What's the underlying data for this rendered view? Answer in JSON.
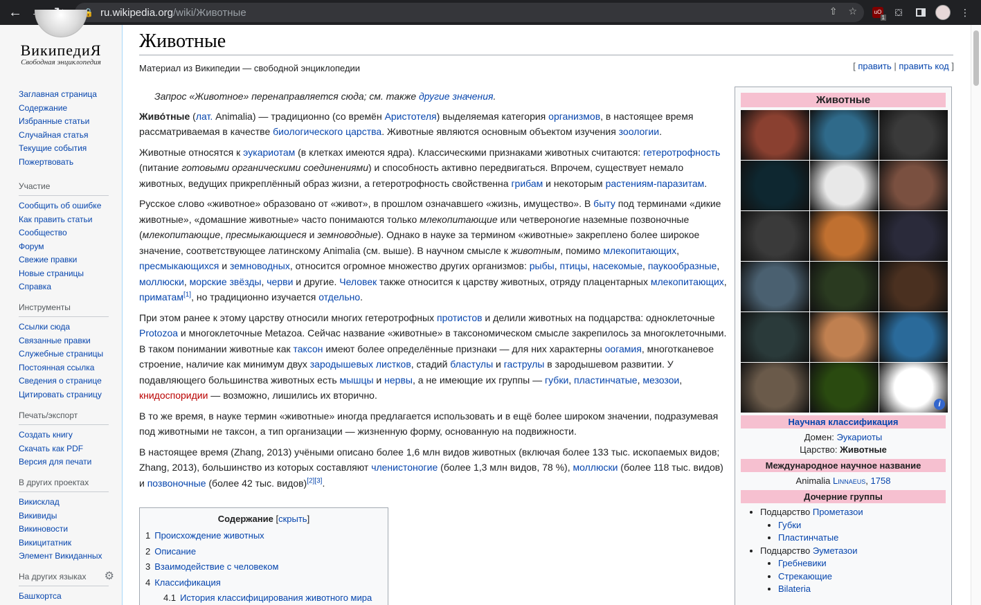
{
  "browser": {
    "url_host": "ru.wikipedia.org",
    "url_path": "/wiki/Животные",
    "ext_badge": "1"
  },
  "logo": {
    "wordmark": "ВикипедиЯ",
    "tagline": "Свободная энциклопедия"
  },
  "nav": {
    "main": [
      "Заглавная страница",
      "Содержание",
      "Избранные статьи",
      "Случайная статья",
      "Текущие события",
      "Пожертвовать"
    ],
    "participation_title": "Участие",
    "participation": [
      "Сообщить об ошибке",
      "Как править статьи",
      "Сообщество",
      "Форум",
      "Свежие правки",
      "Новые страницы",
      "Справка"
    ],
    "tools_title": "Инструменты",
    "tools": [
      "Ссылки сюда",
      "Связанные правки",
      "Служебные страницы",
      "Постоянная ссылка",
      "Сведения о странице",
      "Цитировать страницу"
    ],
    "print_title": "Печать/экспорт",
    "print": [
      "Создать книгу",
      "Скачать как PDF",
      "Версия для печати"
    ],
    "projects_title": "В других проектах",
    "projects": [
      "Викисклад",
      "Викивиды",
      "Викиновости",
      "Викицитатник",
      "Элемент Викиданных"
    ],
    "languages_title": "На других языках",
    "languages": [
      "Башҡортса"
    ]
  },
  "article": {
    "title": "Животные",
    "site_sub": "Материал из Википедии — свободной энциклопедии",
    "edit": "править",
    "edit_source": "править код",
    "hatnote_text": "Запрос «Животное» перенаправляется сюда; см. также ",
    "hatnote_link": "другие значения"
  },
  "toc": {
    "title": "Содержание",
    "hide": "скрыть",
    "items": [
      {
        "num": "1",
        "label": "Происхождение животных"
      },
      {
        "num": "2",
        "label": "Описание"
      },
      {
        "num": "3",
        "label": "Взаимодействие с человеком"
      },
      {
        "num": "4",
        "label": "Классификация"
      },
      {
        "num": "4.1",
        "label": "История классифицирования животного мира"
      }
    ]
  },
  "infobox": {
    "title": "Животные",
    "classification_header": "Научная классификация",
    "domain_label": "Домен:",
    "domain_value": "Эукариоты",
    "kingdom_label": "Царство:",
    "kingdom_value": "Животные",
    "intl_name_header": "Международное научное название",
    "intl_name": "Animalia",
    "intl_author": "Linnaeus",
    "intl_year": "1758",
    "children_header": "Дочерние группы",
    "subkingdom_label": "Подцарство",
    "prometazoa": "Прометазои",
    "prometazoa_children": [
      "Губки",
      "Пластинчатые"
    ],
    "eumetazoa": "Эуметазои",
    "eumetazoa_children": [
      "Гребневики",
      "Стрекающие",
      "Bilateria"
    ],
    "photos": [
      "starfish",
      "sponge-coral",
      "cuttlefish",
      "jellyfish",
      "spotted-beetle",
      "worm",
      "snake",
      "tiger",
      "sea-slug",
      "crustacean",
      "shrimp",
      "moray-eel",
      "crab",
      "red-flatworm",
      "blue-jay",
      "jumping-spider",
      "green-slug",
      "octopus"
    ],
    "photo_colors": [
      "#8a4030",
      "#2f6a8a",
      "#3a3a3a",
      "#0e2730",
      "#e8e8e8",
      "#7a5040",
      "#3a3a3a",
      "#c07030",
      "#2a2a3a",
      "#4a6070",
      "#2a3a20",
      "#4a3020",
      "#2a3a3a",
      "#c08050",
      "#2a6a9a",
      "#6a5a4a",
      "#2a4a10",
      "#ffffff"
    ]
  }
}
